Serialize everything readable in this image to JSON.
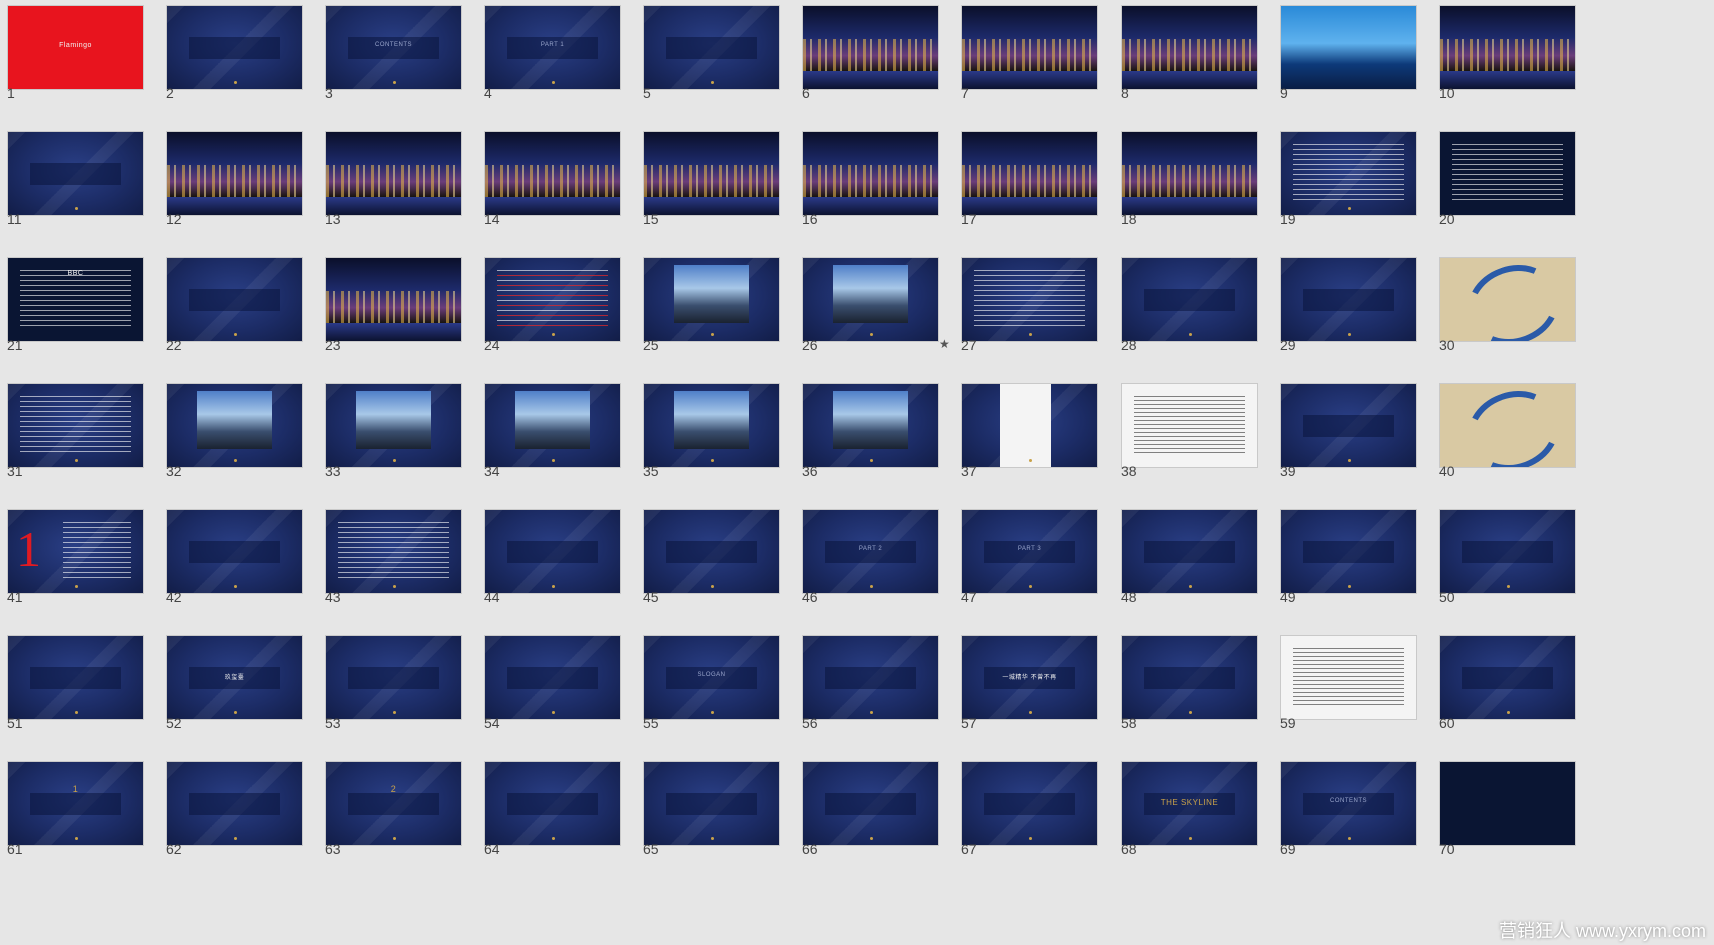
{
  "watermark": "营销狂人 www.yxrym.com",
  "starred_slide": 26,
  "slides": [
    {
      "n": "1",
      "style": "red",
      "text": "Flamingo"
    },
    {
      "n": "2",
      "style": "navy",
      "text": ""
    },
    {
      "n": "3",
      "style": "navy",
      "text": "CONTENTS"
    },
    {
      "n": "4",
      "style": "navy",
      "text": "PART 1"
    },
    {
      "n": "5",
      "style": "navy",
      "text": ""
    },
    {
      "n": "6",
      "style": "photo",
      "text": ""
    },
    {
      "n": "7",
      "style": "photo",
      "text": ""
    },
    {
      "n": "8",
      "style": "photo",
      "text": ""
    },
    {
      "n": "9",
      "style": "blue-city",
      "text": ""
    },
    {
      "n": "10",
      "style": "photo",
      "text": ""
    },
    {
      "n": "11",
      "style": "navy",
      "text": ""
    },
    {
      "n": "12",
      "style": "photo",
      "text": ""
    },
    {
      "n": "13",
      "style": "photo",
      "text": ""
    },
    {
      "n": "14",
      "style": "photo",
      "text": ""
    },
    {
      "n": "15",
      "style": "photo",
      "text": ""
    },
    {
      "n": "16",
      "style": "photo",
      "text": ""
    },
    {
      "n": "17",
      "style": "photo",
      "text": ""
    },
    {
      "n": "18",
      "style": "photo",
      "text": ""
    },
    {
      "n": "19",
      "style": "navy-lines",
      "text": ""
    },
    {
      "n": "20",
      "style": "dark-lines",
      "text": ""
    },
    {
      "n": "21",
      "style": "dark-lines",
      "text": "BBC"
    },
    {
      "n": "22",
      "style": "navy",
      "text": ""
    },
    {
      "n": "23",
      "style": "photo",
      "text": ""
    },
    {
      "n": "24",
      "style": "navy-lines-red",
      "text": ""
    },
    {
      "n": "25",
      "style": "navy-inset",
      "text": ""
    },
    {
      "n": "26",
      "style": "navy-inset",
      "text": ""
    },
    {
      "n": "27",
      "style": "navy-lines",
      "text": ""
    },
    {
      "n": "28",
      "style": "navy",
      "text": ""
    },
    {
      "n": "29",
      "style": "navy",
      "text": ""
    },
    {
      "n": "30",
      "style": "map",
      "text": ""
    },
    {
      "n": "31",
      "style": "navy-lines",
      "text": ""
    },
    {
      "n": "32",
      "style": "navy-inset",
      "text": ""
    },
    {
      "n": "33",
      "style": "navy-inset",
      "text": ""
    },
    {
      "n": "34",
      "style": "navy-inset",
      "text": ""
    },
    {
      "n": "35",
      "style": "navy-inset",
      "text": ""
    },
    {
      "n": "36",
      "style": "navy-inset",
      "text": ""
    },
    {
      "n": "37",
      "style": "navy-white",
      "text": ""
    },
    {
      "n": "38",
      "style": "white-lines",
      "text": ""
    },
    {
      "n": "39",
      "style": "navy",
      "text": ""
    },
    {
      "n": "40",
      "style": "map",
      "text": ""
    },
    {
      "n": "41",
      "style": "navy-one",
      "text": "1"
    },
    {
      "n": "42",
      "style": "navy",
      "text": ""
    },
    {
      "n": "43",
      "style": "navy-lines",
      "text": ""
    },
    {
      "n": "44",
      "style": "navy",
      "text": ""
    },
    {
      "n": "45",
      "style": "navy",
      "text": ""
    },
    {
      "n": "46",
      "style": "navy",
      "text": "PART 2"
    },
    {
      "n": "47",
      "style": "navy",
      "text": "PART 3"
    },
    {
      "n": "48",
      "style": "navy",
      "text": ""
    },
    {
      "n": "49",
      "style": "navy",
      "text": ""
    },
    {
      "n": "50",
      "style": "navy",
      "text": ""
    },
    {
      "n": "51",
      "style": "navy",
      "text": ""
    },
    {
      "n": "52",
      "style": "navy",
      "text": "玖玺臺"
    },
    {
      "n": "53",
      "style": "navy",
      "text": ""
    },
    {
      "n": "54",
      "style": "navy",
      "text": ""
    },
    {
      "n": "55",
      "style": "navy",
      "text": "SLOGAN"
    },
    {
      "n": "56",
      "style": "navy",
      "text": ""
    },
    {
      "n": "57",
      "style": "navy",
      "text": "一城精华 不曾不再"
    },
    {
      "n": "58",
      "style": "navy",
      "text": ""
    },
    {
      "n": "59",
      "style": "white-lines",
      "text": ""
    },
    {
      "n": "60",
      "style": "navy",
      "text": ""
    },
    {
      "n": "61",
      "style": "navy",
      "text": "1"
    },
    {
      "n": "62",
      "style": "navy",
      "text": ""
    },
    {
      "n": "63",
      "style": "navy",
      "text": "2"
    },
    {
      "n": "64",
      "style": "navy",
      "text": ""
    },
    {
      "n": "65",
      "style": "navy",
      "text": ""
    },
    {
      "n": "66",
      "style": "navy",
      "text": ""
    },
    {
      "n": "67",
      "style": "navy",
      "text": ""
    },
    {
      "n": "68",
      "style": "navy",
      "text": "THE SKYLINE"
    },
    {
      "n": "69",
      "style": "navy",
      "text": "CONTENTS"
    },
    {
      "n": "70",
      "style": "dark",
      "text": ""
    }
  ]
}
